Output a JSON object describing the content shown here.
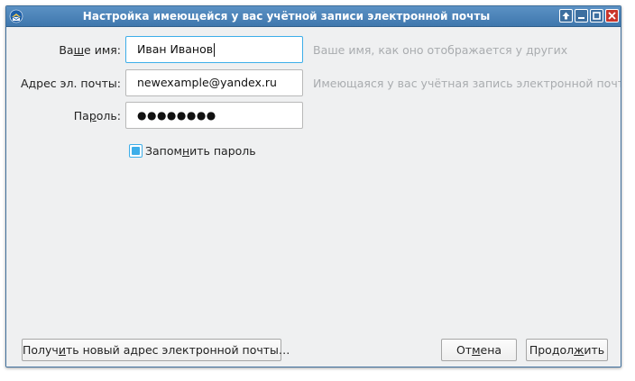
{
  "window": {
    "title": "Настройка имеющейся у вас учётной записи электронной почты"
  },
  "form": {
    "name": {
      "label_pre": "Ва",
      "label_u": "ш",
      "label_post": "е имя:",
      "value": "Иван Иванов",
      "hint": "Ваше имя, как оно отображается у других"
    },
    "email": {
      "label": "Адрес эл. почты:",
      "value": "newexample@yandex.ru",
      "hint": "Имеющаяся у вас учётная запись электронной почты"
    },
    "password": {
      "label_pre": "Па",
      "label_u": "р",
      "label_post": "оль:",
      "value": "●●●●●●●●"
    },
    "remember": {
      "label_pre": "Запом",
      "label_u": "н",
      "label_post": "ить пароль",
      "checked": true
    }
  },
  "buttons": {
    "get_new_pre": "Получ",
    "get_new_u": "и",
    "get_new_post": "ть новый адрес электронной почты…",
    "cancel_pre": "От",
    "cancel_u": "м",
    "cancel_post": "ена",
    "continue_pre": "Продол",
    "continue_u": "ж",
    "continue_post": "ить"
  },
  "colors": {
    "titlebar": "#4a80b6",
    "focus_accent": "#3daee9",
    "close_button": "#c9352b",
    "hint_text": "#a9acaf"
  },
  "icons": {
    "app": "thunderbird-icon",
    "keep_above": "arrow-up-icon",
    "minimize": "minimize-icon",
    "maximize": "maximize-icon",
    "close": "close-icon"
  }
}
